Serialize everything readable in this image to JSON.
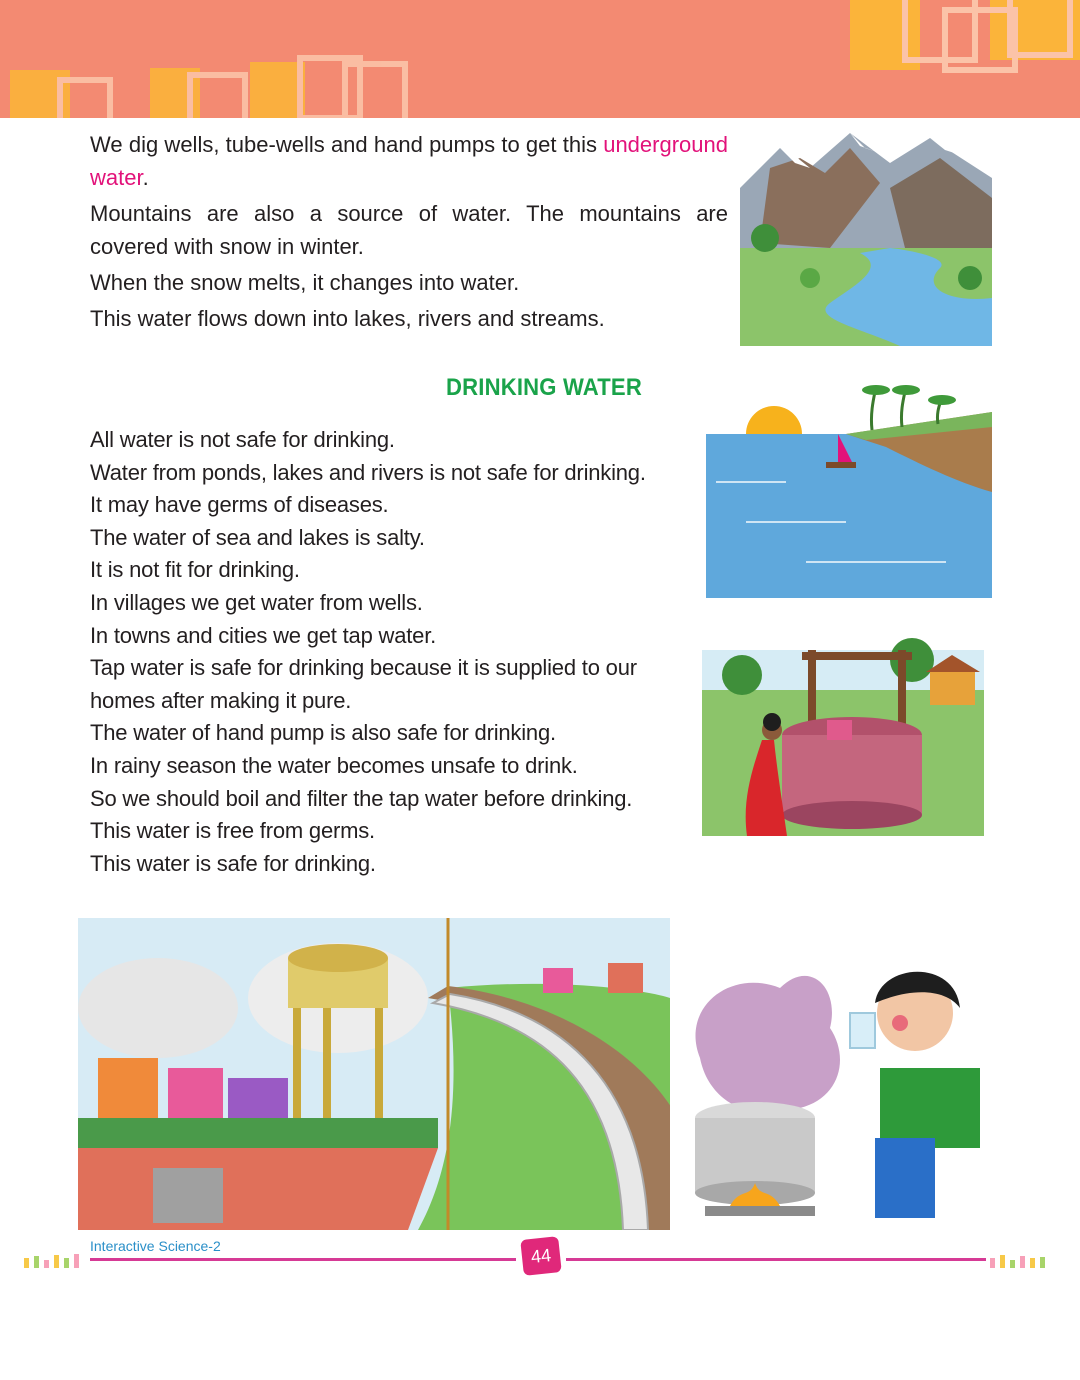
{
  "intro": {
    "line1_a": "We dig wells, tube-wells and hand pumps to get this",
    "line1_highlight": "underground water",
    "line1_end": ".",
    "para2": "Mountains are also a source of water. The mountains are covered with snow in winter.",
    "para3": "When the snow melts, it changes into water.",
    "para4": "This water flows down into lakes, rivers and streams."
  },
  "section_heading": "DRINKING WATER",
  "drinking_lines": [
    "All water is not safe for drinking.",
    "Water from ponds, lakes and rivers is not safe for drinking.",
    "It may have germs of diseases.",
    "The water of sea and lakes is salty.",
    "It is not fit for drinking.",
    "In villages we get water from wells.",
    "In towns and cities we get tap water.",
    "Tap water is safe for drinking because it is supplied to our",
    "homes after making it pure.",
    "The water of hand pump is also safe for drinking.",
    "In rainy season the water becomes unsafe to drink.",
    "So we should boil and filter the tap water before drinking.",
    "This water is free from germs.",
    "This water is safe for drinking."
  ],
  "footer": {
    "book_title": "Interactive Science-2",
    "page_number": "44"
  },
  "colors": {
    "banner": "#f38a72",
    "highlight": "#e2127a",
    "heading": "#1aa34a",
    "footer_line": "#d63a95",
    "footer_title": "#2a8fc8"
  }
}
